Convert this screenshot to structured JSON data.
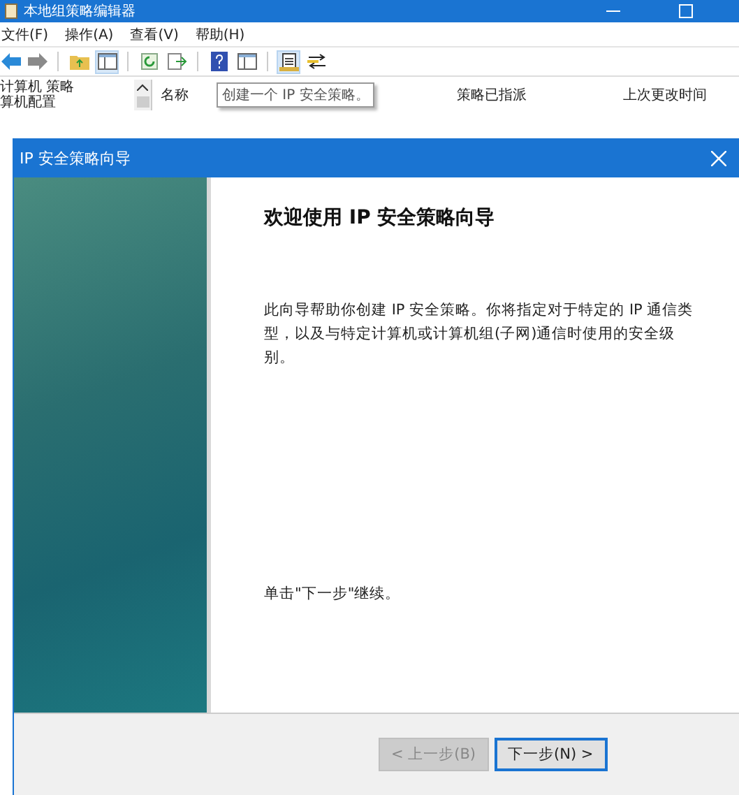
{
  "window": {
    "title": "本地组策略编辑器"
  },
  "menu": [
    "文件(F)",
    "操作(A)",
    "查看(V)",
    "帮助(H)"
  ],
  "toolbar": [
    {
      "kind": "back",
      "disabled": false
    },
    {
      "kind": "forward",
      "disabled": true
    },
    {
      "kind": "sep"
    },
    {
      "kind": "folder-up"
    },
    {
      "kind": "panel",
      "selected": true
    },
    {
      "kind": "sep"
    },
    {
      "kind": "refresh"
    },
    {
      "kind": "export"
    },
    {
      "kind": "sep"
    },
    {
      "kind": "help"
    },
    {
      "kind": "panel",
      "selected": false
    },
    {
      "kind": "sep"
    },
    {
      "kind": "create",
      "selected": true
    },
    {
      "kind": "manage"
    }
  ],
  "tree": {
    "items": [
      "计算机 策略",
      "算机配置"
    ]
  },
  "table": {
    "columns": [
      "名称",
      "策略已指派",
      "上次更改时间"
    ]
  },
  "tooltip": "创建一个 IP 安全策略。",
  "dialog": {
    "title": "IP 安全策略向导",
    "heading": "欢迎使用 IP 安全策略向导",
    "body": "此向导帮助你创建 IP 安全策略。你将指定对于特定的 IP 通信类型，以及与特定计算机或计算机组(子网)通信时使用的安全级别。",
    "footer_note": "单击\"下一步\"继续。",
    "buttons": [
      {
        "label": "< 上一步(B)",
        "disabled": true,
        "selected": false
      },
      {
        "label": "下一步(N) >",
        "disabled": false,
        "selected": true
      }
    ]
  }
}
